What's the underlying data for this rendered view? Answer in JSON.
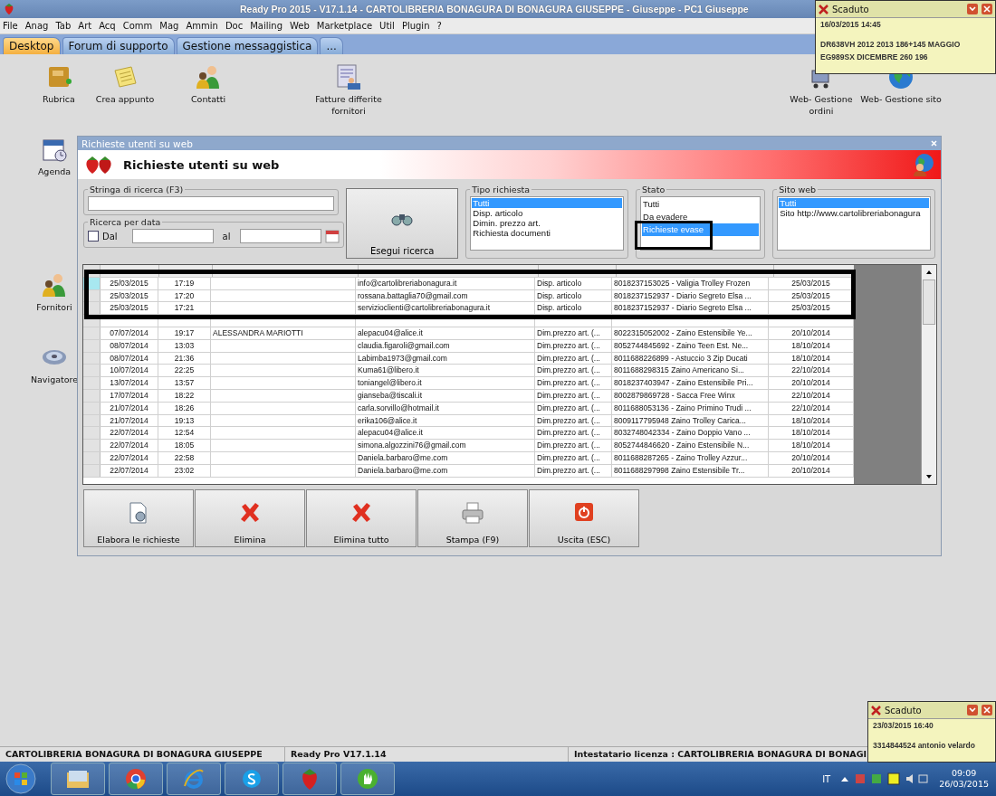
{
  "window": {
    "title": "Ready Pro 2015 - V17.1.14 - CARTOLIBRERIA BONAGURA DI BONAGURA GIUSEPPE - Giuseppe - PC1 Giuseppe"
  },
  "menu": [
    "File",
    "Anag",
    "Tab",
    "Art",
    "Acq",
    "Comm",
    "Mag",
    "Ammin",
    "Doc",
    "Mailing",
    "Web",
    "Marketplace",
    "Util",
    "Plugin",
    "?"
  ],
  "tabs": [
    {
      "label": "Desktop",
      "selected": true
    },
    {
      "label": "Forum di supporto",
      "selected": false
    },
    {
      "label": "Gestione messaggistica",
      "selected": false
    },
    {
      "label": "...",
      "selected": false
    }
  ],
  "desktop_icons": [
    {
      "label": "Rubrica",
      "kind": "book"
    },
    {
      "label": "Crea appunto",
      "kind": "note"
    },
    {
      "label": "Contatti",
      "kind": "people"
    },
    {
      "label": "Fatture differite fornitori",
      "kind": "invoice"
    },
    {
      "label": "Web- Gestione ordini",
      "kind": "cart"
    },
    {
      "label": "Web- Gestione sito",
      "kind": "globe"
    },
    {
      "label": "Agenda",
      "kind": "calendar"
    },
    {
      "label": "Fornitori",
      "kind": "people"
    },
    {
      "label": "Navigatore",
      "kind": "disc"
    }
  ],
  "dialog": {
    "title": "Richieste utenti su web",
    "heading": "Richieste utenti su web",
    "search": {
      "label": "Stringa di ricerca (F3)"
    },
    "date_search": {
      "label": "Ricerca per data",
      "checkbox": {
        "label": "Dal",
        "checked": false
      },
      "to_label": "al"
    },
    "search_button": "Esegui ricerca",
    "lists": [
      {
        "title": "Tipo richiesta",
        "items": [
          {
            "label": "Tutti",
            "selected": true
          },
          {
            "label": "Disp. articolo",
            "selected": false
          },
          {
            "label": "Dimin. prezzo art.",
            "selected": false
          },
          {
            "label": "Richiesta documenti",
            "selected": false
          }
        ]
      },
      {
        "title": "Stato",
        "items": [
          {
            "label": "Tutti",
            "selected": false
          },
          {
            "label": "Da evadere",
            "selected": false
          },
          {
            "label": "Richieste evase",
            "selected": true
          }
        ]
      },
      {
        "title": "Sito web",
        "items": [
          {
            "label": "Tutti",
            "selected": true
          },
          {
            "label": "Sito http://www.cartolibreriabonagura",
            "selected": false
          }
        ]
      }
    ],
    "table": {
      "rows": [
        {
          "selected": true,
          "column_1": "25/03/2015",
          "column_2": "17:19",
          "column_4": "info@cartolibreriabonagura.it",
          "column_5": "Disp. articolo",
          "column_6": "8018237153025 - Valigia Trolley Frozen",
          "column_7": "25/03/2015"
        },
        {
          "selected": false,
          "column_1": "25/03/2015",
          "column_2": "17:20",
          "column_4": "rossana.battaglia70@gmail.com",
          "column_5": "Disp. articolo",
          "column_6": "8018237152937 - Diario Segreto Elsa ...",
          "column_7": "25/03/2015"
        },
        {
          "selected": false,
          "column_1": "25/03/2015",
          "column_2": "17:21",
          "column_4": "servizioclienti@cartolibreriabonagura.it",
          "column_5": "Disp. articolo",
          "column_6": "8018237152937 - Diario Segreto Elsa ...",
          "column_7": "25/03/2015"
        },
        {
          "selected": false
        },
        {
          "selected": false,
          "column_1": "07/07/2014",
          "column_2": "19:17",
          "column_3": "ALESSANDRA MARIOTTI",
          "column_4": "alepacu04@alice.it",
          "column_5": "Dim.prezzo art. (...",
          "column_6": "8022315052002 - Zaino Estensibile Ye...",
          "column_7": "20/10/2014"
        },
        {
          "selected": false,
          "column_1": "08/07/2014",
          "column_2": "13:03",
          "column_4": "claudia.figaroli@gmail.com",
          "column_5": "Dim.prezzo art. (...",
          "column_6": "8052744845692 - Zaino Teen Est. Ne...",
          "column_7": "18/10/2014"
        },
        {
          "selected": false,
          "column_1": "08/07/2014",
          "column_2": "21:36",
          "column_4": "Labimba1973@gmail.com",
          "column_5": "Dim.prezzo art. (...",
          "column_6": "8011688226899 - Astuccio 3 Zip Ducati",
          "column_7": "18/10/2014"
        },
        {
          "selected": false,
          "column_1": "10/07/2014",
          "column_2": "22:25",
          "column_4": "Kuma61@libero.it",
          "column_5": "Dim.prezzo art. (...",
          "column_6": "8011688298315 Zaino Americano Si...",
          "column_7": "22/10/2014"
        },
        {
          "selected": false,
          "column_1": "13/07/2014",
          "column_2": "13:57",
          "column_4": "toniangel@libero.it",
          "column_5": "Dim.prezzo art. (...",
          "column_6": "8018237403947 - Zaino Estensibile Pri...",
          "column_7": "20/10/2014"
        },
        {
          "selected": false,
          "column_1": "17/07/2014",
          "column_2": "18:22",
          "column_4": "gianseba@tiscali.it",
          "column_5": "Dim.prezzo art. (...",
          "column_6": "8002879869728 - Sacca Free Winx",
          "column_7": "22/10/2014"
        },
        {
          "selected": false,
          "column_1": "21/07/2014",
          "column_2": "18:26",
          "column_4": "carla.sorvillo@hotmail.it",
          "column_5": "Dim.prezzo art. (...",
          "column_6": "8011688053136 - Zaino Primino Trudi ...",
          "column_7": "22/10/2014"
        },
        {
          "selected": false,
          "column_1": "21/07/2014",
          "column_2": "19:13",
          "column_4": "erika106@alice.it",
          "column_5": "Dim.prezzo art. (...",
          "column_6": "8009117795948 Zaino Trolley Carica...",
          "column_7": "18/10/2014"
        },
        {
          "selected": false,
          "column_1": "22/07/2014",
          "column_2": "12:54",
          "column_4": "alepacu04@alice.it",
          "column_5": "Dim.prezzo art. (...",
          "column_6": "8032748042334 - Zaino Doppio Vano ...",
          "column_7": "18/10/2014"
        },
        {
          "selected": false,
          "column_1": "22/07/2014",
          "column_2": "18:05",
          "column_4": "simona.algozzini76@gmail.com",
          "column_5": "Dim.prezzo art. (...",
          "column_6": "8052744846620 - Zaino Estensibile N...",
          "column_7": "18/10/2014"
        },
        {
          "selected": false,
          "column_1": "22/07/2014",
          "column_2": "22:58",
          "column_4": "Daniela.barbaro@me.com",
          "column_5": "Dim.prezzo art. (...",
          "column_6": "8011688287265 - Zaino Trolley Azzur...",
          "column_7": "20/10/2014"
        },
        {
          "selected": false,
          "column_1": "22/07/2014",
          "column_2": "23:02",
          "column_4": "Daniela.barbaro@me.com",
          "column_5": "Dim.prezzo art. (...",
          "column_6": "8011688297998 Zaino Estensibile Tr...",
          "column_7": "20/10/2014"
        }
      ]
    },
    "buttons": [
      {
        "label": "Elabora le richieste",
        "kind": "process"
      },
      {
        "label": "Elimina",
        "kind": "delete"
      },
      {
        "label": "Elimina tutto",
        "kind": "delete"
      },
      {
        "label": "Stampa (F9)",
        "kind": "print"
      },
      {
        "label": "Uscita (ESC)",
        "kind": "exit"
      }
    ]
  },
  "status_bar": [
    "CARTOLIBRERIA BONAGURA DI BONAGURA GIUSEPPE",
    "Ready Pro V17.1.14",
    "Intestatario licenza : CARTOLIBRERIA BONAGURA DI BONAGI"
  ],
  "notifications": [
    {
      "title": "Scaduto",
      "lines": [
        "16/03/2015  14:45",
        "DR638VH     2012 2013  186+145  MAGGIO",
        "EG989SX  DICEMBRE  260  196"
      ]
    },
    {
      "title": "Scaduto",
      "lines": [
        "23/03/2015  16:40",
        "3314844524 antonio velardo"
      ]
    }
  ],
  "taskbar": {
    "apps": [
      {
        "kind": "explorer"
      },
      {
        "kind": "chrome"
      },
      {
        "kind": "ie"
      },
      {
        "kind": "skype"
      },
      {
        "kind": "strawberry"
      },
      {
        "kind": "green"
      }
    ],
    "language": "IT",
    "time": "09:09",
    "date": "26/03/2015"
  }
}
